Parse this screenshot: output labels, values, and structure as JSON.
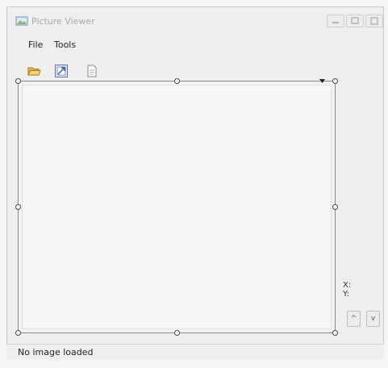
{
  "window": {
    "title": "Picture Viewer"
  },
  "menu": {
    "file": "File",
    "tools": "Tools"
  },
  "toolbar": {
    "open_icon": "folder-open-icon",
    "zoom_icon": "picture-zoom-icon",
    "doc_icon": "document-icon"
  },
  "coords": {
    "x_label": "X:",
    "y_label": "Y:"
  },
  "nav": {
    "up": "^",
    "down": "v"
  },
  "status": {
    "text": "No image loaded"
  }
}
